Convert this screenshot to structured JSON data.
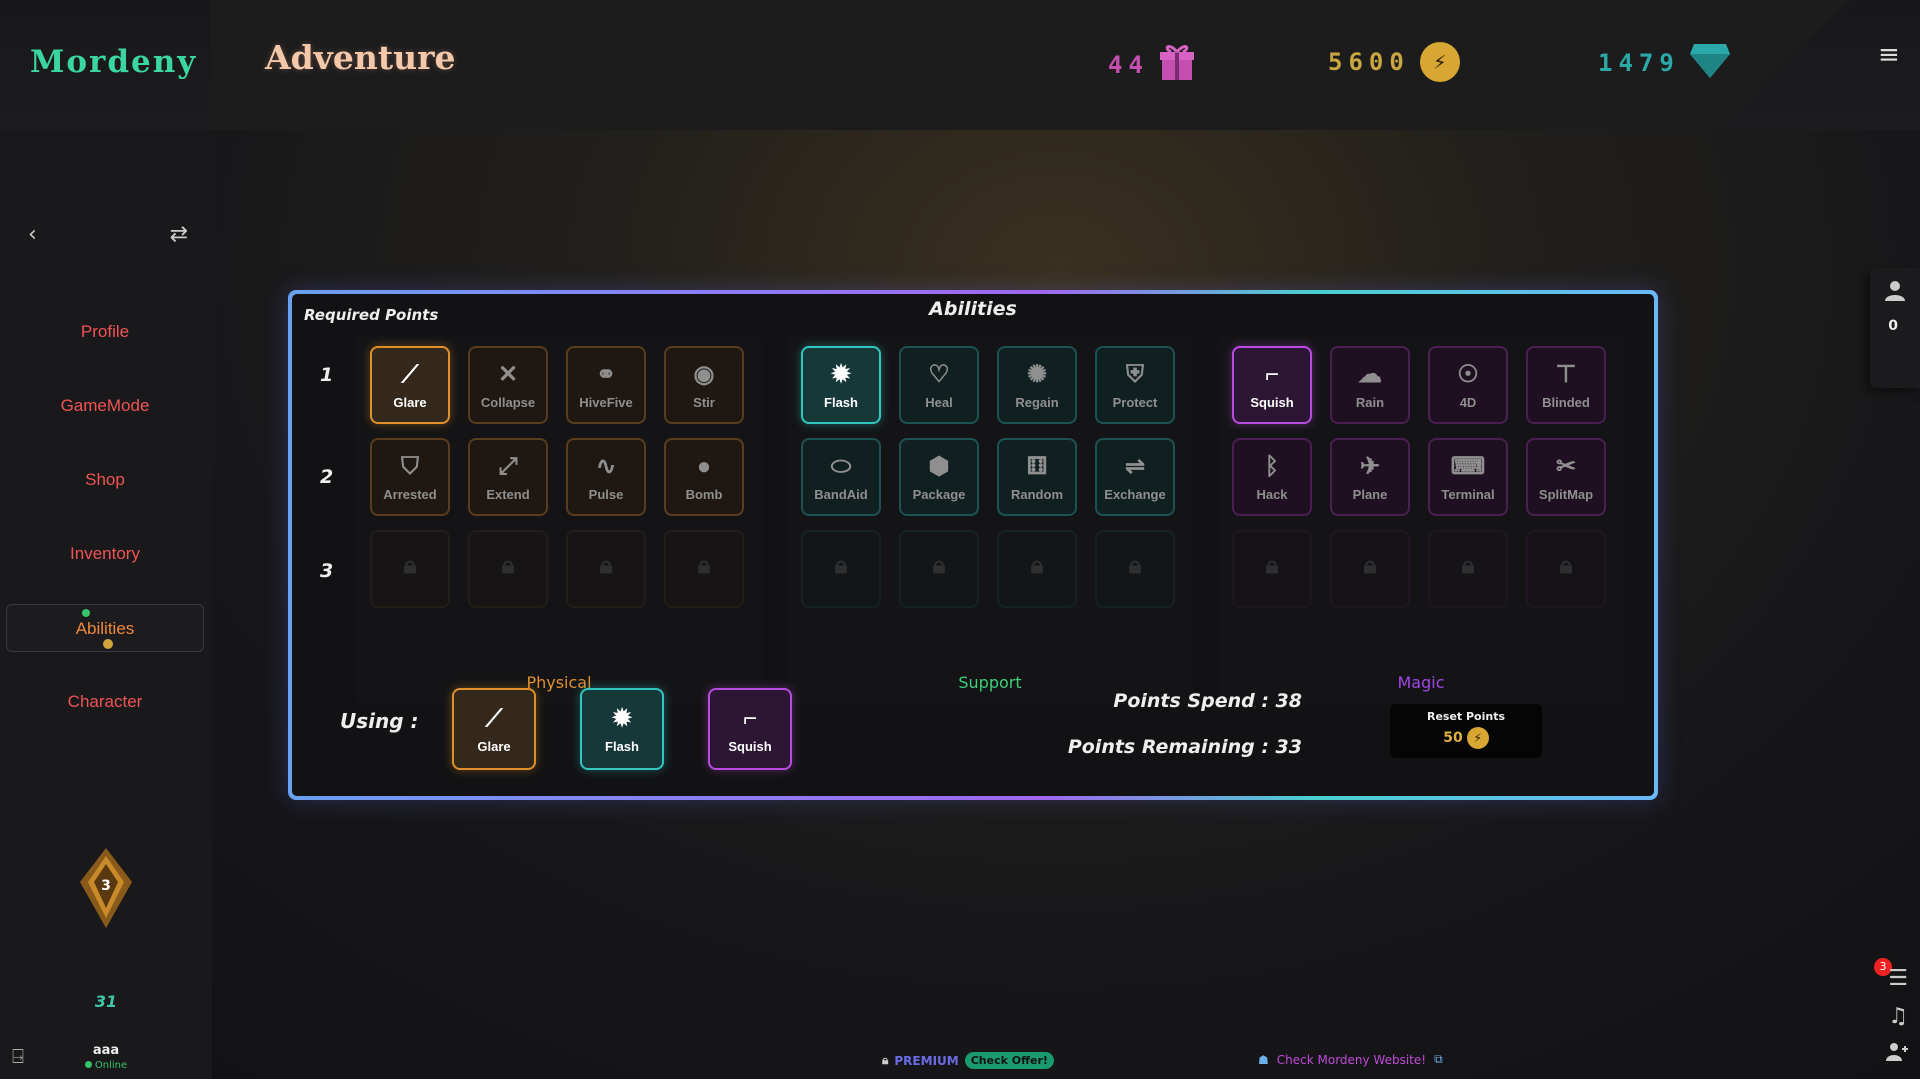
{
  "header": {
    "logo": "Mordeny",
    "title": "Adventure",
    "gifts": "44",
    "coins": "5600",
    "gems": "1479"
  },
  "sidebar": {
    "items": [
      {
        "label": "Profile"
      },
      {
        "label": "GameMode"
      },
      {
        "label": "Shop"
      },
      {
        "label": "Inventory"
      },
      {
        "label": "Abilities"
      },
      {
        "label": "Character"
      }
    ],
    "rank": "3",
    "level": "31",
    "username": "aaa",
    "status": "Online"
  },
  "right_rail": {
    "friends_count": "0",
    "notification_count": "3"
  },
  "panel": {
    "title": "Abilities",
    "required_label": "Required Points",
    "rows": [
      "1",
      "2",
      "3"
    ],
    "groups": [
      {
        "label": "Physical",
        "color": "#e0902a",
        "row1": [
          "Glare",
          "Collapse",
          "HiveFive",
          "Stir"
        ],
        "row2": [
          "Arrested",
          "Extend",
          "Pulse",
          "Bomb"
        ]
      },
      {
        "label": "Support",
        "color": "#3cd07a",
        "row1": [
          "Flash",
          "Heal",
          "Regain",
          "Protect"
        ],
        "row2": [
          "BandAid",
          "Package",
          "Random",
          "Exchange"
        ]
      },
      {
        "label": "Magic",
        "color": "#a046e8",
        "row1": [
          "Squish",
          "Rain",
          "4D",
          "Blinded"
        ],
        "row2": [
          "Hack",
          "Plane",
          "Terminal",
          "SplitMap"
        ]
      }
    ],
    "using_label": "Using :",
    "using": [
      "Glare",
      "Flash",
      "Squish"
    ],
    "points_spend": "Points Spend : 38",
    "points_remaining": "Points Remaining : 33",
    "reset_label": "Reset Points",
    "reset_cost": "50"
  },
  "footer": {
    "premium": "PREMIUM",
    "check_offer": "Check Offer!",
    "website": "Check Mordeny Website!"
  }
}
